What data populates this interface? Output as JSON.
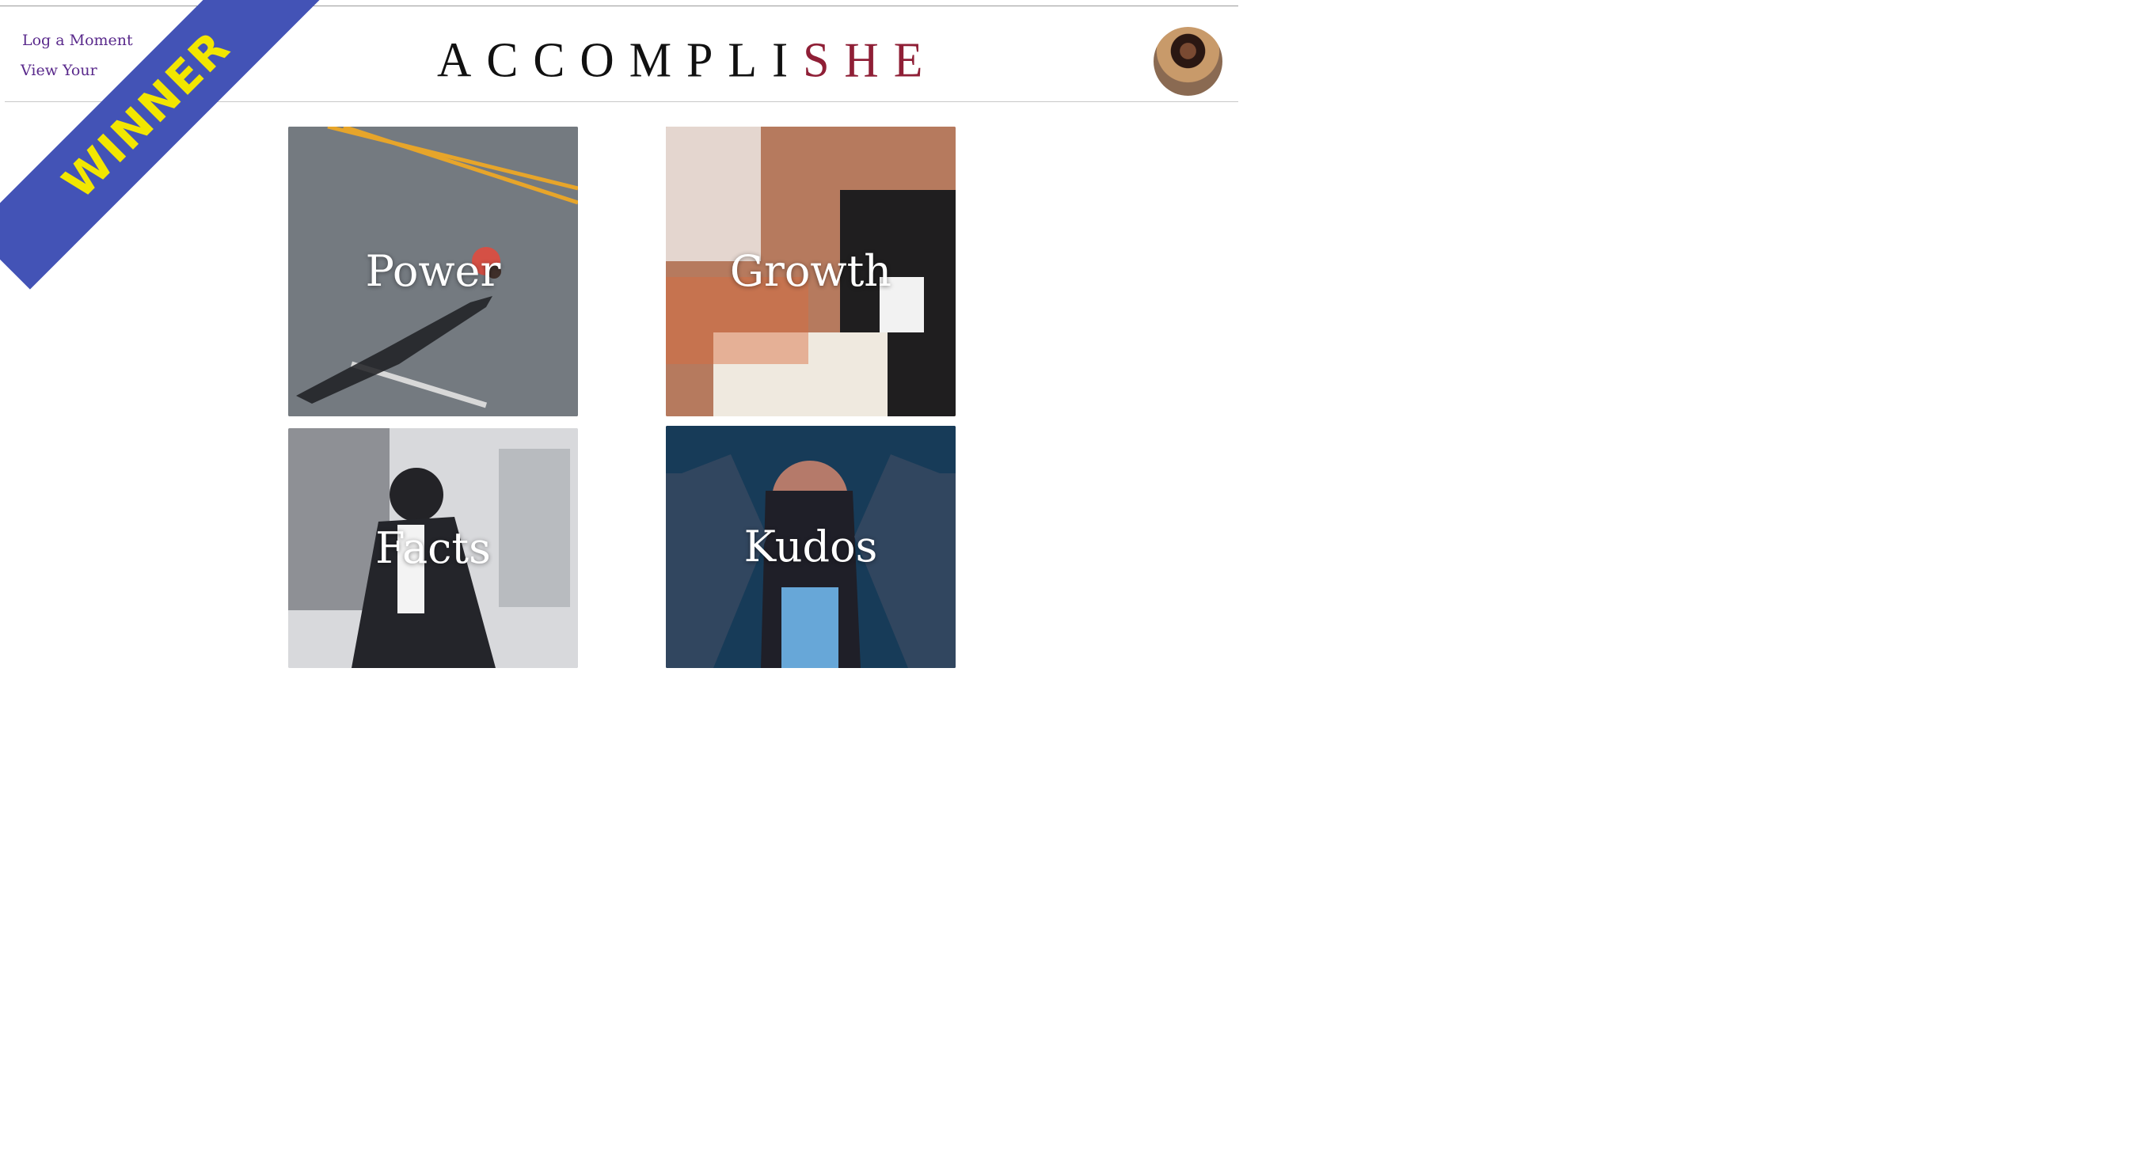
{
  "brand": {
    "logo_main": "ACCOMPLI",
    "logo_accent": "SHE",
    "accent_color": "#8f1f36",
    "link_color": "#5a2a8c"
  },
  "nav": {
    "log_moment": "Log a Moment",
    "view_yours": "View Your"
  },
  "ribbon": {
    "label": "WINNER",
    "color": "#4353b6",
    "text_color": "#f2e600"
  },
  "tiles": [
    {
      "label": "Power"
    },
    {
      "label": "Growth"
    },
    {
      "label": "Facts"
    },
    {
      "label": "Kudos"
    }
  ]
}
